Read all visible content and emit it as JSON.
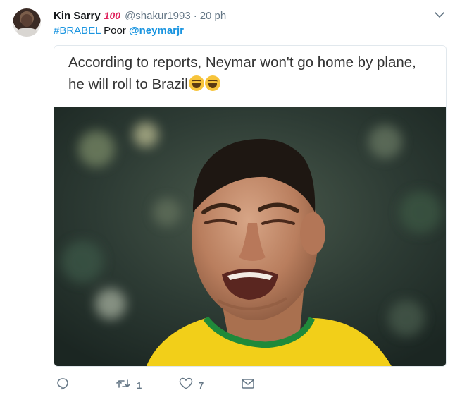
{
  "tweet": {
    "author_name": "Kin Sarry",
    "author_emoji_label": "100",
    "handle": "@shakur1993",
    "separator": "·",
    "timestamp": "20 ph",
    "hashtag": "#BRABEL",
    "text_word": "Poor",
    "mention": "@neymarjr",
    "more_icon": "chevron-down-icon"
  },
  "media": {
    "caption": "According to reports, Neymar won't go home by plane, he will roll to Brazil",
    "caption_emojis": [
      "face-with-tears-of-joy",
      "face-with-tears-of-joy"
    ],
    "photo_description_icon": "crying-football-player-photo"
  },
  "actions": {
    "reply_icon": "reply-icon",
    "retweet_icon": "retweet-icon",
    "retweet_count": "1",
    "like_icon": "heart-icon",
    "like_count": "7",
    "dm_icon": "envelope-icon"
  },
  "colors": {
    "link": "#1b95e0",
    "secondary_text": "#657786",
    "border": "#e1e8ed",
    "jersey_yellow": "#f5d000",
    "jersey_green": "#1f8a3a"
  }
}
